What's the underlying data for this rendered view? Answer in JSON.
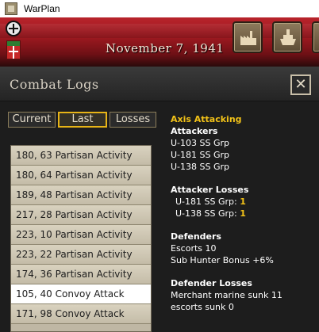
{
  "window": {
    "title": "WarPlan"
  },
  "header": {
    "date": "November 7, 1941",
    "buttons": [
      {
        "icon": "factory-icon"
      },
      {
        "icon": "ship-icon"
      }
    ]
  },
  "panel": {
    "title": "Combat Logs",
    "close_label": "✕",
    "tabs": [
      "Current",
      "Last",
      "Losses"
    ],
    "active_tab": "Last",
    "list": [
      "180, 63 Partisan Activity",
      "180, 64 Partisan Activity",
      "189, 48 Partisan Activity",
      "217, 28 Partisan Activity",
      "223, 10 Partisan Activity",
      "223, 22 Partisan Activity",
      "174, 36 Partisan Activity",
      "105, 40 Convoy Attack",
      "171, 98 Convoy Attack"
    ],
    "selected_index": 7,
    "details": {
      "side": "Axis Attacking",
      "attackers_header": "Attackers",
      "attackers": [
        "U-103 SS Grp",
        "U-181 SS Grp",
        "U-138 SS Grp"
      ],
      "attacker_losses_header": "Attacker Losses",
      "attacker_losses": [
        {
          "unit": "U-181 SS Grp:",
          "value": "1"
        },
        {
          "unit": "U-138 SS Grp:",
          "value": "1"
        }
      ],
      "defenders_header": "Defenders",
      "defenders": [
        "Escorts 10",
        "Sub Hunter Bonus +6%"
      ],
      "defender_losses_header": "Defender Losses",
      "defender_losses": [
        "Merchant marine sunk 11",
        "escorts sunk 0"
      ]
    }
  },
  "colors": {
    "accent": "#f2c218",
    "header_red": "#9d1920",
    "list_bg": "#bfb7a4"
  }
}
